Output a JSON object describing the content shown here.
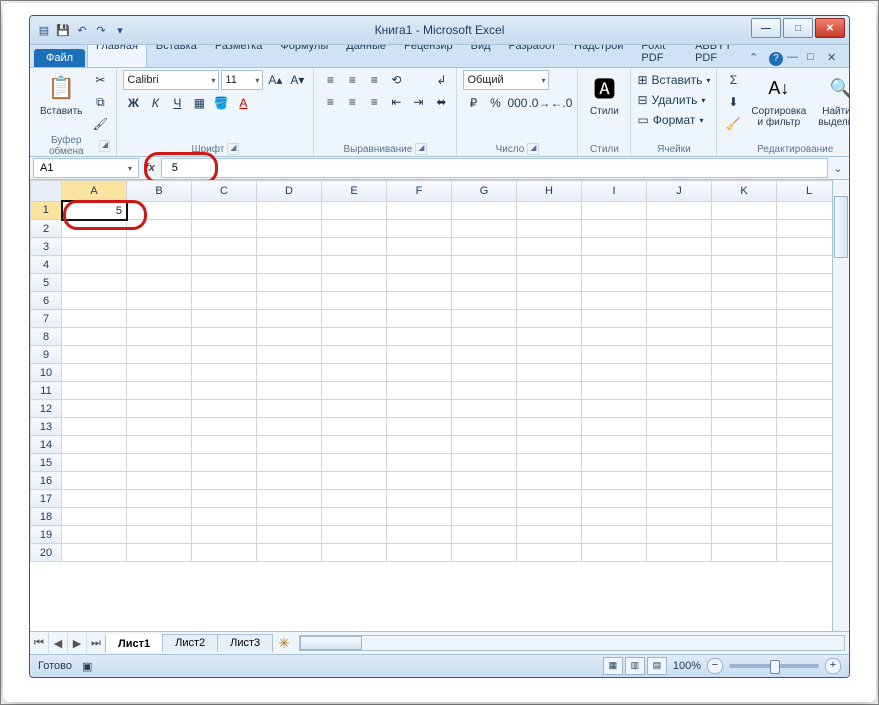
{
  "title": "Книга1  -  Microsoft Excel",
  "qat": {
    "save": "💾",
    "undo": "↶",
    "redo": "↷",
    "more": "▾"
  },
  "wctl": {
    "min": "—",
    "max": "□",
    "close": "✕"
  },
  "tabs": {
    "file": "Файл",
    "items": [
      "Главная",
      "Вставка",
      "Разметка",
      "Формулы",
      "Данные",
      "Рецензир",
      "Вид",
      "Разработ",
      "Надстрой",
      "Foxit PDF",
      "ABBYY PDF"
    ],
    "active": 0
  },
  "help": {
    "up": "⌃",
    "help": "?",
    "mdi_min": "—",
    "mdi_max": "□",
    "mdi_close": "✕"
  },
  "ribbon": {
    "clipboard": {
      "title": "Буфер обмена",
      "paste": "Вставить",
      "paste_ic": "📋",
      "cut": "✂",
      "copy": "⧉",
      "fmtp": "🖌"
    },
    "font": {
      "title": "Шрифт",
      "name": "Calibri",
      "size": "11",
      "grow": "A▴",
      "shrink": "A▾",
      "bold": "Ж",
      "italic": "К",
      "underline": "Ч",
      "border": "▦",
      "fill": "🪣",
      "color": "A"
    },
    "align": {
      "title": "Выравнивание",
      "tl": "≡",
      "tc": "≡",
      "tr": "≡",
      "ml": "≡",
      "mc": "≡",
      "mr": "≡",
      "wrap": "↲",
      "merge": "⬌",
      "il": "⇤",
      "ir": "⇥",
      "rot": "⟲"
    },
    "number": {
      "title": "Число",
      "format": "Общий",
      "cur": "₽",
      "pct": "%",
      "sep": "000",
      "inc": ".0→",
      "dec": "←.0"
    },
    "styles": {
      "title": "Стили",
      "label": "Стили",
      "ic": "🅰"
    },
    "cells": {
      "title": "Ячейки",
      "insert": "Вставить",
      "delete": "Удалить",
      "format": "Формат",
      "ii": "⊞",
      "di": "⊟",
      "fi": "▭"
    },
    "editing": {
      "title": "Редактирование",
      "sum": "Σ",
      "fill": "⬇",
      "clear": "🧹",
      "sort": "Сортировка\nи фильтр",
      "find": "Найти и\nвыделить",
      "sic": "A↓",
      "fic": "🔍"
    }
  },
  "fbar": {
    "name": "A1",
    "fx": "fx",
    "value": "5"
  },
  "grid": {
    "cols": [
      "A",
      "B",
      "C",
      "D",
      "E",
      "F",
      "G",
      "H",
      "I",
      "J",
      "K",
      "L"
    ],
    "rows": 20,
    "sel": {
      "r": 1,
      "c": 0,
      "val": "5"
    }
  },
  "sheets": {
    "nav": [
      "⏮",
      "◀",
      "▶",
      "⏭"
    ],
    "tabs": [
      "Лист1",
      "Лист2",
      "Лист3"
    ],
    "active": 0,
    "new": "✳"
  },
  "status": {
    "ready": "Готово",
    "rec": "▣",
    "views": [
      "▦",
      "▥",
      "▤"
    ],
    "zoom": "100%",
    "minus": "−",
    "plus": "+"
  }
}
